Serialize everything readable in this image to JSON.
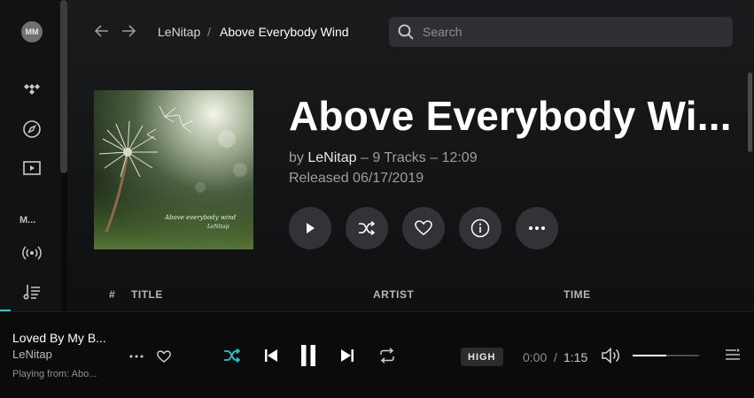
{
  "sidebar": {
    "avatar_initials": "MM",
    "section_label": "M...",
    "icons": [
      "tidal-logo-icon",
      "compass-icon",
      "video-icon",
      "broadcast-icon",
      "playlist-icon"
    ]
  },
  "header": {
    "breadcrumb_artist": "LeNitap",
    "breadcrumb_separator": "/",
    "breadcrumb_album": "Above Everybody Wind"
  },
  "search": {
    "placeholder": "Search"
  },
  "album": {
    "title": "Above Everybody Wi...",
    "by_prefix": "by",
    "artist": "LeNitap",
    "meta_suffix": "– 9 Tracks – 12:09",
    "released": "Released 06/17/2019",
    "cover_text": "Above everybody wind",
    "cover_subtext": "LeNitap"
  },
  "tracklist": {
    "columns": [
      "#",
      "TITLE",
      "ARTIST",
      "TIME"
    ]
  },
  "player": {
    "now_playing_title": "Loved By My B...",
    "now_playing_artist": "LeNitap",
    "playing_from": "Playing from:  Abo...",
    "quality": "HIGH",
    "elapsed": "0:00",
    "time_separator": "/",
    "duration": "1:15",
    "volume_level": 0.5
  },
  "colors": {
    "accent": "#24c9d6",
    "background": "#0a0a0b",
    "button": "#323336"
  }
}
